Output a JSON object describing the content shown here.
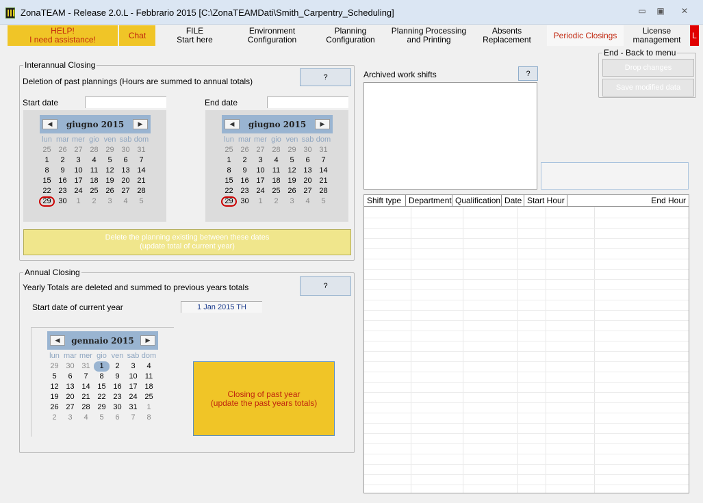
{
  "window": {
    "title": "ZonaTEAM - Release 2.0.L - Febbrario 2015 [C:\\ZonaTEAMDati\\Smith_Carpentry_Scheduling]",
    "minimize": "▭",
    "maximize": "▣",
    "close": "✕"
  },
  "tabs": [
    {
      "line1": "HELP!",
      "line2": "I need assistance!"
    },
    {
      "line1": "Chat",
      "line2": ""
    },
    {
      "line1": "FILE",
      "line2": "Start here"
    },
    {
      "line1": "Environment",
      "line2": "Configuration"
    },
    {
      "line1": "Planning Configuration",
      "line2": ""
    },
    {
      "line1": "Planning Processing",
      "line2": "and Printing"
    },
    {
      "line1": "Absents Replacement",
      "line2": ""
    },
    {
      "line1": "Periodic Closings",
      "line2": ""
    },
    {
      "line1": "License",
      "line2": "management"
    },
    {
      "line1": "L",
      "line2": ""
    }
  ],
  "interannual": {
    "title": "Interannual Closing",
    "description": "Deletion of past plannings (Hours are summed to annual totals)",
    "help_label": "?",
    "start_label": "Start date",
    "end_label": "End date",
    "delete_line1": "Delete the planning existing between these dates",
    "delete_line2": "(update total of current year)"
  },
  "calendar_june": {
    "month": "giugno 2015",
    "prev": "◀",
    "next": "▶",
    "dow": [
      "lun",
      "mar",
      "mer",
      "gio",
      "ven",
      "sab",
      "dom"
    ],
    "weeks": [
      [
        "25",
        "26",
        "27",
        "28",
        "29",
        "30",
        "31"
      ],
      [
        "1",
        "2",
        "3",
        "4",
        "5",
        "6",
        "7"
      ],
      [
        "8",
        "9",
        "10",
        "11",
        "12",
        "13",
        "14"
      ],
      [
        "15",
        "16",
        "17",
        "18",
        "19",
        "20",
        "21"
      ],
      [
        "22",
        "23",
        "24",
        "25",
        "26",
        "27",
        "28"
      ],
      [
        "29",
        "30",
        "1",
        "2",
        "3",
        "4",
        "5"
      ]
    ]
  },
  "calendar_jan": {
    "month": "gennaio 2015",
    "prev": "◀",
    "next": "▶",
    "dow": [
      "lun",
      "mar",
      "mer",
      "gio",
      "ven",
      "sab",
      "dom"
    ],
    "weeks": [
      [
        "29",
        "30",
        "31",
        "1",
        "2",
        "3",
        "4"
      ],
      [
        "5",
        "6",
        "7",
        "8",
        "9",
        "10",
        "11"
      ],
      [
        "12",
        "13",
        "14",
        "15",
        "16",
        "17",
        "18"
      ],
      [
        "19",
        "20",
        "21",
        "22",
        "23",
        "24",
        "25"
      ],
      [
        "26",
        "27",
        "28",
        "29",
        "30",
        "31",
        "1"
      ],
      [
        "2",
        "3",
        "4",
        "5",
        "6",
        "7",
        "8"
      ]
    ]
  },
  "annual": {
    "title": "Annual Closing",
    "description": "Yearly Totals are deleted and summed to previous years totals",
    "help_label": "?",
    "start_label": "Start date of current year",
    "start_value": "1 Jan 2015 TH",
    "closing_line1": "Closing of past year",
    "closing_line2": "(update the past years totals)"
  },
  "archived": {
    "label": "Archived work shifts",
    "help_label": "?"
  },
  "end_menu": {
    "title": "End - Back to menu",
    "drop_label": "Drop changes",
    "save_label": "Save modified data"
  },
  "table": {
    "columns": [
      "Shift type",
      "Department",
      "Qualification",
      "Date",
      "Start Hour",
      "End Hour"
    ]
  },
  "colors": {
    "accent_yellow": "#f0c527",
    "accent_red_text": "#c0260e",
    "calendar_header": "#99b4d1"
  }
}
